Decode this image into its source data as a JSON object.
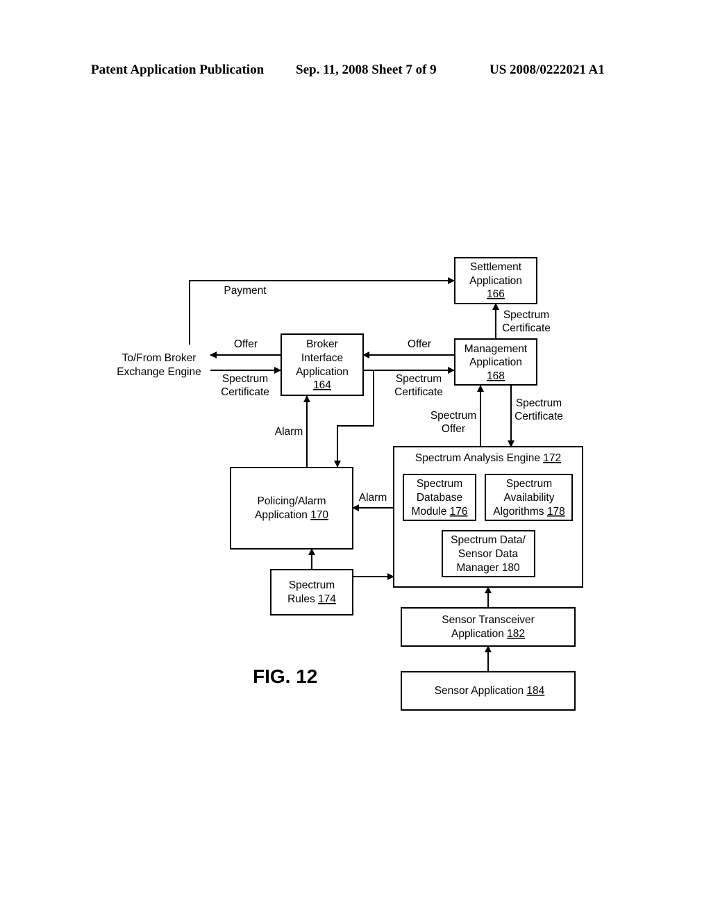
{
  "header": {
    "left": "Patent Application Publication",
    "middle": "Sep. 11, 2008   Sheet 7 of 9",
    "right": "US 2008/0222021 A1"
  },
  "figure_label": "FIG. 12",
  "external": {
    "line1": "To/From Broker",
    "line2": "Exchange Engine"
  },
  "boxes": {
    "settlement": {
      "lines": [
        "Settlement",
        "Application"
      ],
      "ref": "166"
    },
    "broker": {
      "lines": [
        "Broker",
        "Interface",
        "Application"
      ],
      "ref": "164"
    },
    "management": {
      "lines": [
        "Management",
        "Application"
      ],
      "ref": "168"
    },
    "policing": {
      "lines": [
        "Policing/Alarm"
      ],
      "line2_prefix": "Application ",
      "ref": "170"
    },
    "analysis": {
      "prefix": "Spectrum Analysis Engine ",
      "ref": "172"
    },
    "database": {
      "lines": [
        "Spectrum",
        "Database"
      ],
      "line3_prefix": "Module ",
      "ref": "176"
    },
    "availability": {
      "lines": [
        "Spectrum",
        "Availability"
      ],
      "line3_prefix": "Algorithms ",
      "ref": "178"
    },
    "datamanager": {
      "lines": [
        "Spectrum Data/",
        "Sensor Data",
        "Manager 180"
      ]
    },
    "rules": {
      "lines": [
        "Spectrum"
      ],
      "line2_prefix": "Rules ",
      "ref": "174"
    },
    "transceiver": {
      "lines": [
        "Sensor Transceiver"
      ],
      "line2_prefix": "Application ",
      "ref": "182"
    },
    "sensor": {
      "prefix": "Sensor Application ",
      "ref": "184"
    }
  },
  "edge_labels": {
    "payment": "Payment",
    "offer_left": "Offer",
    "cert_left": [
      "Spectrum",
      "Certificate"
    ],
    "offer_mid": "Offer",
    "cert_mid": [
      "Spectrum",
      "Certificate"
    ],
    "cert_up": [
      "Spectrum",
      "Certificate"
    ],
    "spectrum_offer": [
      "Spectrum",
      "Offer"
    ],
    "cert_down": [
      "Spectrum",
      "Certificate"
    ],
    "alarm_up": "Alarm",
    "alarm_left": "Alarm"
  }
}
